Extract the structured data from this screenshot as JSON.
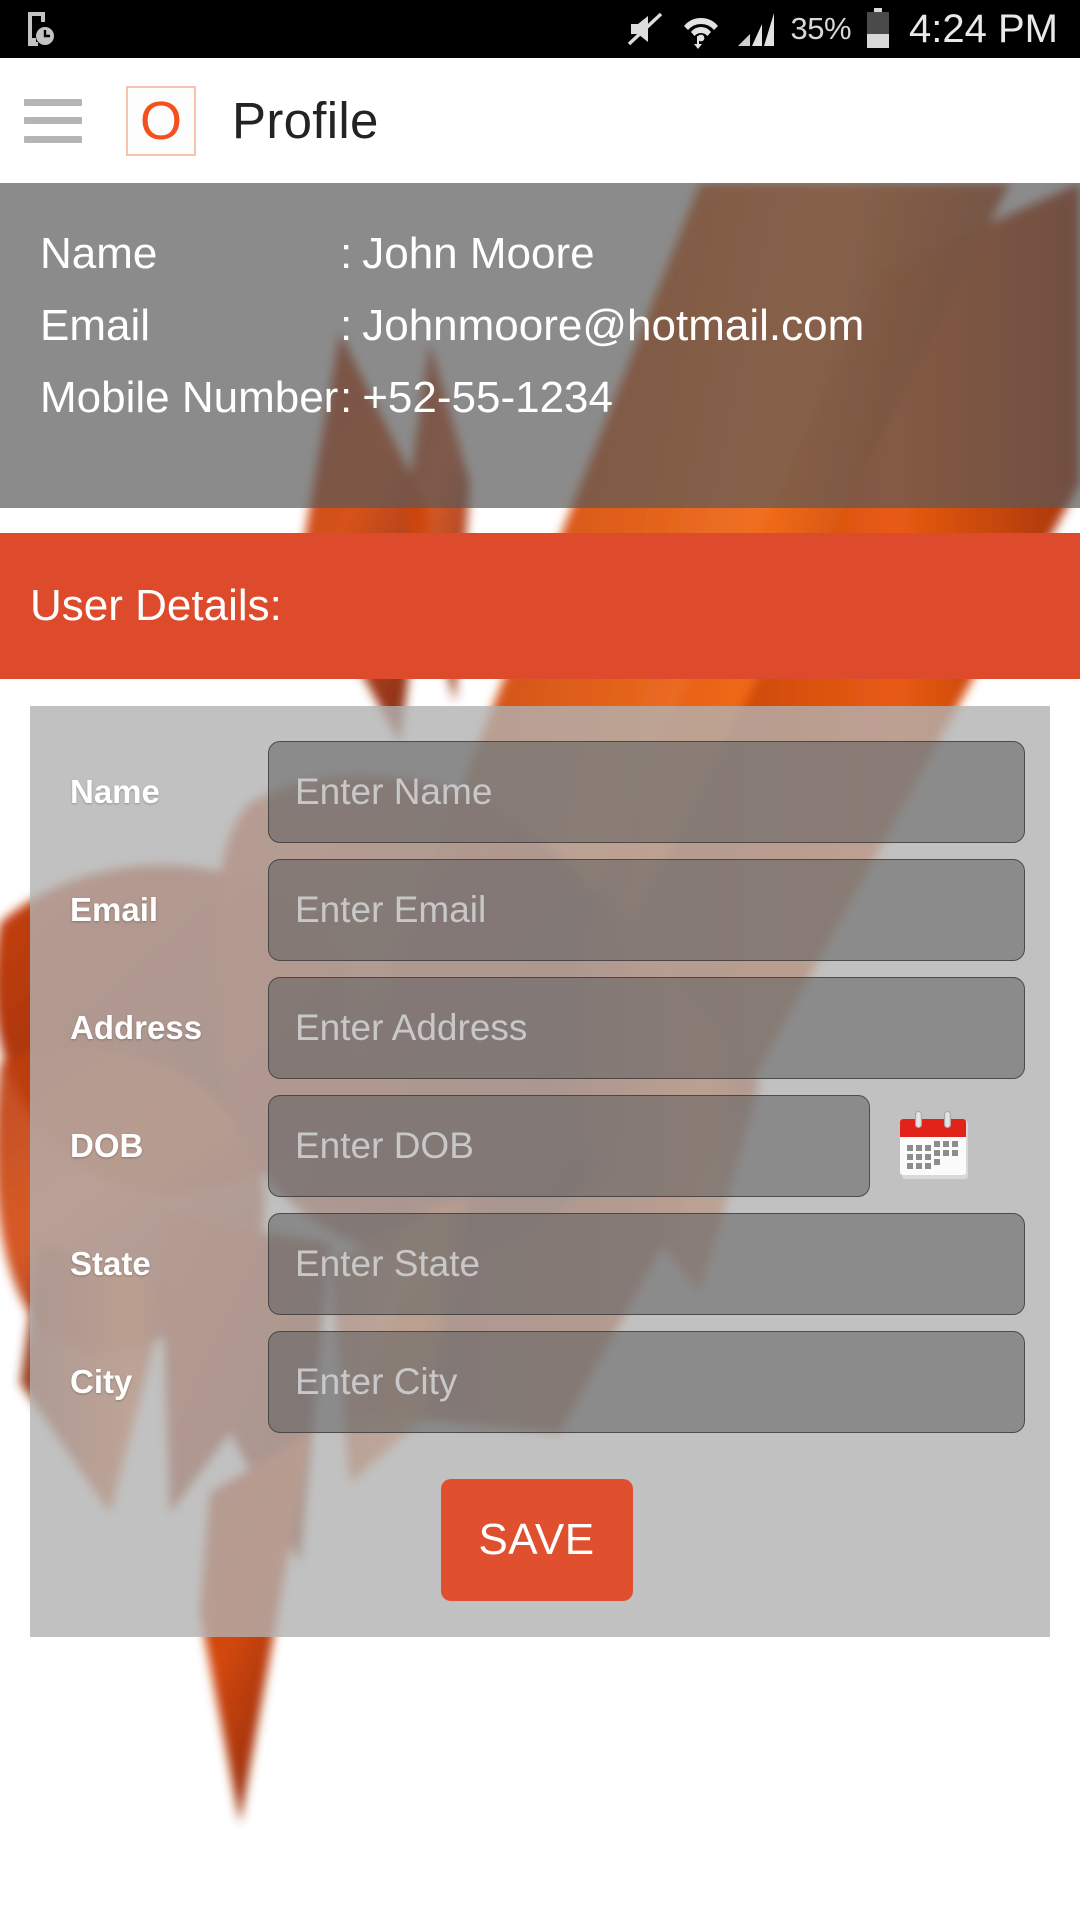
{
  "status_bar": {
    "left_icons": [
      "phone-clock-icon"
    ],
    "right_icons": [
      "mute-icon",
      "wifi-icon",
      "signal-icon"
    ],
    "battery_percent": "35%",
    "clock": "4:24 PM"
  },
  "app_bar": {
    "menu_icon": "hamburger-menu-icon",
    "logo_letter": "O",
    "title": "Profile"
  },
  "profile": {
    "rows": [
      {
        "label": "Name",
        "separator": ":",
        "value": "John Moore"
      },
      {
        "label": "Email",
        "separator": ":",
        "value": "Johnmoore@hotmail.com"
      },
      {
        "label": "Mobile Number",
        "separator": ":",
        "value": "+52-55-1234"
      }
    ]
  },
  "section": {
    "title": "User Details:"
  },
  "form": {
    "fields": [
      {
        "label": "Name",
        "placeholder": "Enter Name",
        "value": "",
        "has_calendar": false
      },
      {
        "label": "Email",
        "placeholder": "Enter Email",
        "value": "",
        "has_calendar": false
      },
      {
        "label": "Address",
        "placeholder": "Enter Address",
        "value": "",
        "has_calendar": false
      },
      {
        "label": "DOB",
        "placeholder": "Enter DOB",
        "value": "",
        "has_calendar": true
      },
      {
        "label": "State",
        "placeholder": "Enter State",
        "value": "",
        "has_calendar": false
      },
      {
        "label": "City",
        "placeholder": "Enter City",
        "value": "",
        "has_calendar": false
      }
    ],
    "calendar_icon": "calendar-icon",
    "save_label": "SAVE"
  },
  "colors": {
    "accent_orange": "#dd4b2c",
    "save_button": "#e0502f",
    "logo_orange": "#f4501e",
    "status_bar_bg": "#000000",
    "profile_band": "rgba(90,90,90,0.70)",
    "form_panel": "rgba(178,178,178,0.80)",
    "input_fill": "rgba(95,95,95,0.55)",
    "placeholder_text": "#c8c8c8",
    "label_text": "#ffffff"
  }
}
